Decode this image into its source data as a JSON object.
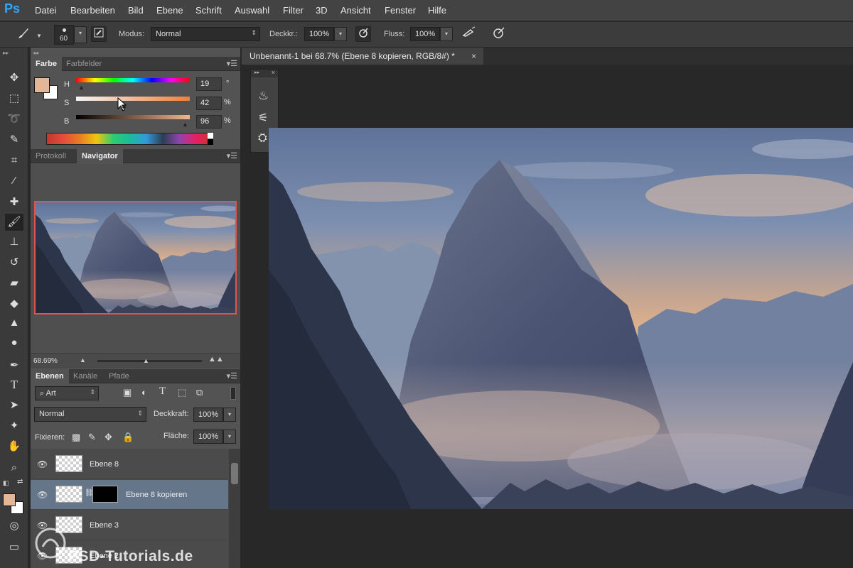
{
  "app": {
    "logo": "Ps"
  },
  "menu": [
    "Datei",
    "Bearbeiten",
    "Bild",
    "Ebene",
    "Schrift",
    "Auswahl",
    "Filter",
    "3D",
    "Ansicht",
    "Fenster",
    "Hilfe"
  ],
  "options_bar": {
    "brush_size": "60",
    "mode_label": "Modus:",
    "mode_value": "Normal",
    "opacity_label": "Deckkr.:",
    "opacity_value": "100%",
    "flow_label": "Fluss:",
    "flow_value": "100%",
    "icons": [
      "brush-preset-icon",
      "brush-panel-icon",
      "pressure-opacity-icon",
      "airbrush-icon",
      "pressure-size-icon"
    ]
  },
  "color_panel": {
    "tabs": [
      "Farbe",
      "Farbfelder"
    ],
    "active_tab": "Farbe",
    "h_label": "H",
    "h_value": "19",
    "h_unit": "°",
    "s_label": "S",
    "s_value": "42",
    "s_unit": "%",
    "b_label": "B",
    "b_value": "96",
    "b_unit": "%",
    "foreground_color": "#e2b696",
    "background_color": "#ffffff"
  },
  "navigator_panel": {
    "tabs": [
      "Protokoll",
      "Navigator"
    ],
    "active_tab": "Navigator",
    "zoom": "68.69%",
    "view_box_color": "#e0524f"
  },
  "layers_panel": {
    "tabs": [
      "Ebenen",
      "Kanäle",
      "Pfade"
    ],
    "active_tab": "Ebenen",
    "filter_label": "Art",
    "blend_mode": "Normal",
    "opacity_label": "Deckkraft:",
    "opacity_value": "100%",
    "lock_label": "Fixieren:",
    "fill_label": "Fläche:",
    "fill_value": "100%",
    "layers": [
      {
        "name": "Ebene 8",
        "selected": false,
        "has_mask": false
      },
      {
        "name": "Ebene 8 kopieren",
        "selected": true,
        "has_mask": true
      },
      {
        "name": "Ebene 3",
        "selected": false,
        "has_mask": false
      },
      {
        "name": "Ebene 2",
        "selected": false,
        "has_mask": false
      }
    ]
  },
  "document": {
    "tab_title": "Unbenannt-1 bei 68.7% (Ebene 8 kopieren, RGB/8#) *",
    "close_glyph": "×"
  },
  "toolbar": {
    "tools": [
      "move-tool-icon",
      "marquee-tool-icon",
      "lasso-tool-icon",
      "quick-selection-tool-icon",
      "crop-tool-icon",
      "eyedropper-tool-icon",
      "healing-brush-tool-icon",
      "brush-tool-icon",
      "clone-stamp-tool-icon",
      "history-brush-tool-icon",
      "eraser-tool-icon",
      "paint-bucket-tool-icon",
      "blur-tool-icon",
      "dodge-tool-icon",
      "pen-tool-icon",
      "type-tool-icon",
      "path-selection-tool-icon",
      "shape-tool-icon",
      "hand-tool-icon",
      "zoom-tool-icon"
    ],
    "active_tool": "brush-tool-icon"
  },
  "watermark": "PSD-Tutorials.de",
  "colors": {
    "sky_orange": "#e9b589",
    "sky_blue": "#6f84a8",
    "mountain": "#4a5874",
    "forest": "#2b3244"
  }
}
